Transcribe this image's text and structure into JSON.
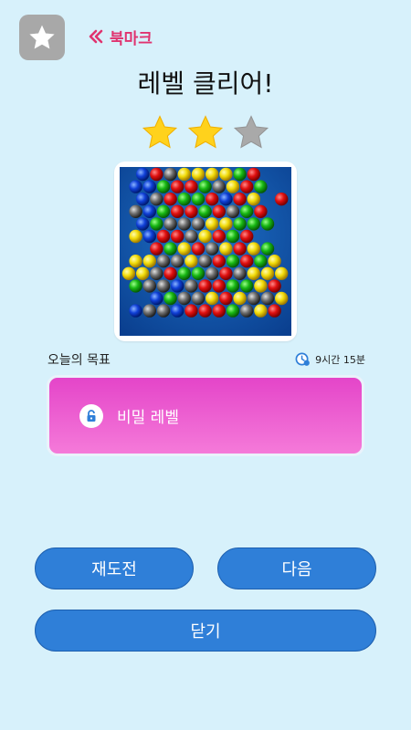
{
  "header": {
    "bookmark_label": "북마크"
  },
  "title": "레벨 클리어!",
  "rating": {
    "stars_earned": 2,
    "stars_total": 3
  },
  "goal": {
    "label": "오늘의 목표",
    "time_remaining": "9시간 15분",
    "card_text": "비밀 레벨"
  },
  "buttons": {
    "retry": "재도전",
    "next": "다음",
    "close": "닫기"
  },
  "colors": {
    "background": "#d7f1fb",
    "accent": "#e0336f",
    "button": "#2f7fd8",
    "star_filled": "#ffd21c",
    "star_empty": "#a9a9a9"
  },
  "icons": [
    "star-icon",
    "chevron-double-left-icon",
    "clock-icon",
    "lock-icon"
  ]
}
